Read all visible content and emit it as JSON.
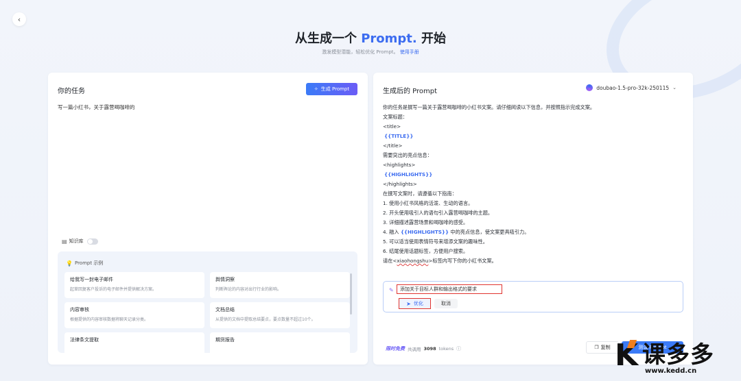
{
  "header": {
    "title_prefix": "从生成一个",
    "title_accent": "Prompt.",
    "title_suffix": "开始",
    "subtitle": "激发模型潜能，轻松优化 Prompt。",
    "manual_link": "使用手册"
  },
  "left_card": {
    "title": "你的任务",
    "generate_button": "生成 Prompt",
    "task_text": "写一篇小红书，关于露营喝咖啡的",
    "knowledge_base_label": "知识库",
    "knowledge_base_enabled": false,
    "examples_header": "Prompt 示例",
    "examples": [
      {
        "title": "给我写一封电子邮件",
        "desc": "起草回复客户投诉的电子邮件并提供解决方案。"
      },
      {
        "title": "舆情洞察",
        "desc": "判断舆论的内容对出行行业的影响。"
      },
      {
        "title": "内容审核",
        "desc": "根据提供的内容审核数据将聊天记录分类。"
      },
      {
        "title": "文档总结",
        "desc": "从提供的文档中提取总结要点，要点数量不超过10个。"
      },
      {
        "title": "法律条文提取",
        "desc": ""
      },
      {
        "title": "期货报告",
        "desc": ""
      }
    ]
  },
  "right_card": {
    "title": "生成后的 Prompt",
    "model": "doubao-1.5-pro-32k-250115",
    "lines": [
      "你的任务是撰写一篇关于露营喝咖啡的小红书文案。请仔细阅读以下信息，并按照指示完成文案。",
      "文案标题：",
      "<title>",
      "{{TITLE}}",
      "</title>",
      "需要突出的亮点信息：",
      "<highlights>",
      "{{HIGHLIGHTS}}",
      "</highlights>",
      "在撰写文案时，请遵循以下指南：",
      "1. 使用小红书风格的活泼、生动的语言。",
      "2. 开头使用吸引人的语句引入露营喝咖啡的主题。",
      "3. 详细描述露营场景和喝咖啡的感受。"
    ],
    "line_4_pre": "4. 融入 ",
    "line_4_var": "{{HIGHLIGHTS}}",
    "line_4_post": " 中的亮点信息，使文案更具吸引力。",
    "line_5": "5. 可以适当使用表情符号来增添文案的趣味性。",
    "line_6": "6. 结尾使用话题标签，方便用户搜索。",
    "line_last_pre": "请在<",
    "line_last_tag": "xiaohongshu",
    "line_last_post": ">标签内写下你的小红书文案。",
    "optimize_input": "添加关于目标人群和输出格式的要求",
    "optimize_button": "优化",
    "cancel_button": "取消",
    "free_badge": "限时免费",
    "tokens_prefix": "共调用",
    "tokens_count": "3098",
    "tokens_suffix": "tokens",
    "copy_button": "复制",
    "test_button": "测试 Prompt"
  },
  "watermark": {
    "text": "课多多",
    "url": "www.kedd.cn"
  },
  "colors": {
    "accent": "#3c6cf0",
    "highlight_red": "#e0332f"
  }
}
